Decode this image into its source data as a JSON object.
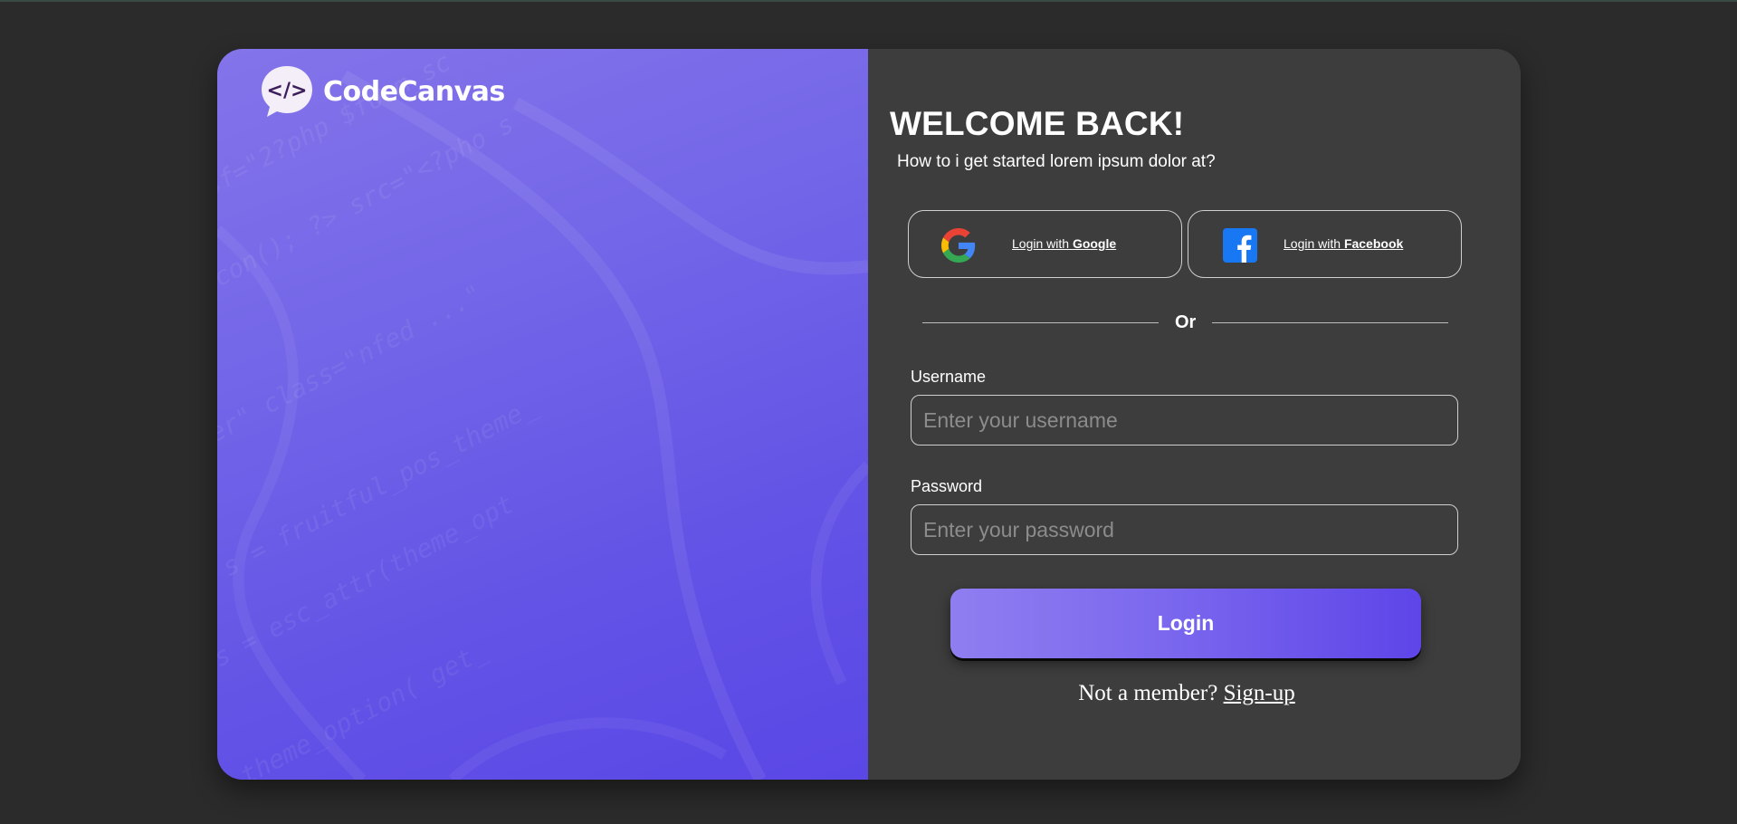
{
  "brand": {
    "name": "CodeCanvas",
    "logo_icon": "code-brackets-chat-bubble",
    "logo_glyph": "</>",
    "panel_color_top": "#8474ea",
    "panel_color_bottom": "#5a47e6"
  },
  "form": {
    "title": "WELCOME BACK!",
    "subtitle": "How to i get started lorem ipsum dolor at?",
    "social": {
      "google": {
        "icon": "google-icon",
        "prefix": "Login with ",
        "provider": "Google"
      },
      "facebook": {
        "icon": "facebook-icon",
        "prefix": "Login with ",
        "provider": "Facebook"
      }
    },
    "divider_text": "Or",
    "username": {
      "label": "Username",
      "placeholder": "Enter your username",
      "value": ""
    },
    "password": {
      "label": "Password",
      "placeholder": "Enter your password",
      "value": ""
    },
    "login_button": "Login",
    "signup_prompt": "Not a member? ",
    "signup_link": "Sign-up"
  },
  "colors": {
    "page_background": "#2b2b2b",
    "form_background": "#3d3d3d",
    "accent_start": "#8f7ef0",
    "accent_end": "#5d45e8",
    "google_blue": "#4285F4",
    "google_red": "#EA4335",
    "google_yellow": "#FBBC05",
    "google_green": "#34A853",
    "facebook_blue": "#1877F2"
  }
}
